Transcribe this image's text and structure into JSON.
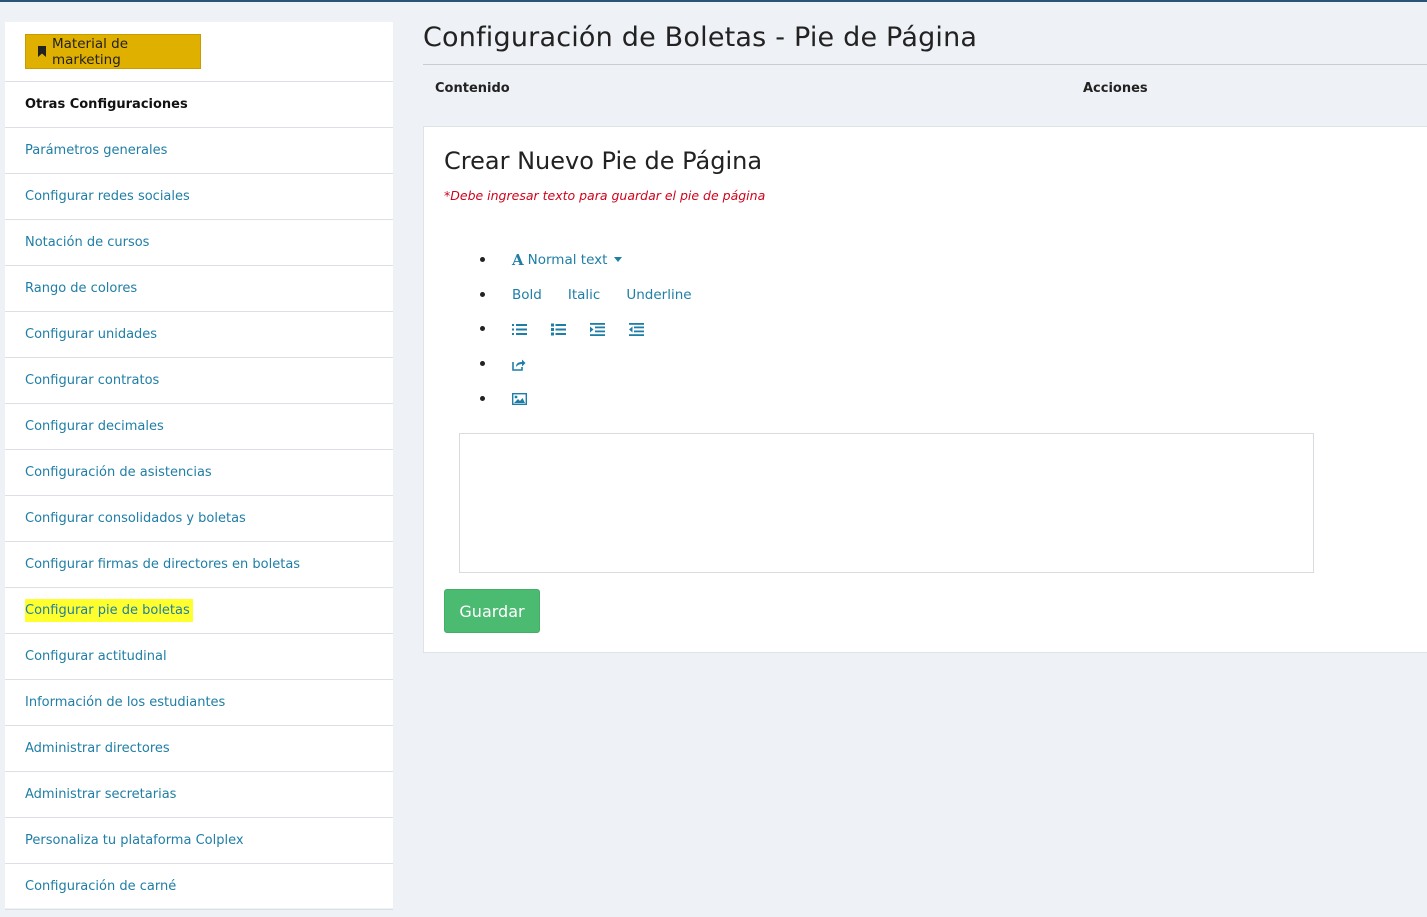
{
  "sidebar": {
    "marketing_label": "Material de marketing",
    "section_header": "Otras Configuraciones",
    "items": [
      {
        "label": "Parámetros generales"
      },
      {
        "label": "Configurar redes sociales"
      },
      {
        "label": "Notación de cursos"
      },
      {
        "label": "Rango de colores"
      },
      {
        "label": "Configurar unidades"
      },
      {
        "label": "Configurar contratos"
      },
      {
        "label": "Configurar decimales"
      },
      {
        "label": "Configuración de asistencias"
      },
      {
        "label": "Configurar consolidados y boletas"
      },
      {
        "label": "Configurar firmas de directores en boletas"
      },
      {
        "label": "Configurar pie de boletas",
        "highlighted": true
      },
      {
        "label": "Configurar actitudinal"
      },
      {
        "label": "Información de los estudiantes"
      },
      {
        "label": "Administrar directores"
      },
      {
        "label": "Administrar secretarias"
      },
      {
        "label": "Personaliza tu plataforma Colplex"
      },
      {
        "label": "Configuración de carné"
      }
    ]
  },
  "main": {
    "title": "Configuración de Boletas - Pie de Página",
    "table_headers": {
      "content": "Contenido",
      "actions": "Acciones"
    },
    "panel": {
      "title": "Crear Nuevo Pie de Página",
      "warning": "*Debe ingresar texto para guardar el pie de página",
      "toolbar": {
        "font_style": "Normal text",
        "bold": "Bold",
        "italic": "Italic",
        "underline": "Underline",
        "list_icons": [
          "unordered-list-icon",
          "ordered-list-icon",
          "indent-icon",
          "outdent-icon"
        ],
        "link_icon": "share-link-icon",
        "image_icon": "image-icon"
      },
      "editor_value": "",
      "save_label": "Guardar"
    }
  },
  "colors": {
    "accent_link": "#1f7ea6",
    "marketing_button": "#e0b000",
    "highlight": "#ffff2e",
    "save_button": "#4cbb72",
    "warning": "#d0021b",
    "top_bar": "#2b5376"
  }
}
